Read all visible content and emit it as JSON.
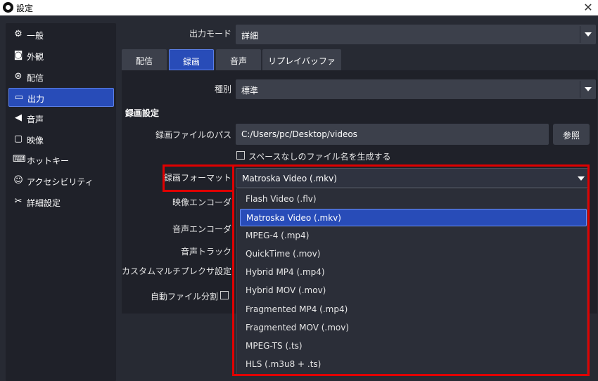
{
  "window": {
    "title": "設定",
    "close_glyph": "✕"
  },
  "sidebar": {
    "items": [
      {
        "label": "一般",
        "icon": "gear-icon",
        "glyph": "⚙"
      },
      {
        "label": "外観",
        "icon": "appearance-icon",
        "glyph": "◙"
      },
      {
        "label": "配信",
        "icon": "broadcast-icon",
        "glyph": "⊛"
      },
      {
        "label": "出力",
        "icon": "output-icon",
        "glyph": "▭"
      },
      {
        "label": "音声",
        "icon": "speaker-icon",
        "glyph": "◀"
      },
      {
        "label": "映像",
        "icon": "monitor-icon",
        "glyph": "▢"
      },
      {
        "label": "ホットキー",
        "icon": "keyboard-icon",
        "glyph": "⌨"
      },
      {
        "label": "アクセシビリティ",
        "icon": "accessibility-icon",
        "glyph": "☺"
      },
      {
        "label": "詳細設定",
        "icon": "tools-icon",
        "glyph": "✂"
      }
    ],
    "active_index": 3
  },
  "output_mode": {
    "label": "出力モード",
    "value": "詳細"
  },
  "tabs": [
    {
      "label": "配信"
    },
    {
      "label": "録画"
    },
    {
      "label": "音声"
    },
    {
      "label": "リプレイバッファ"
    }
  ],
  "active_tab": 1,
  "type_field": {
    "label": "種別",
    "value": "標準"
  },
  "recording_section": {
    "title": "録画設定",
    "path_label": "録画ファイルのパス",
    "path_value": "C:/Users/pc/Desktop/videos",
    "browse_label": "参照",
    "nospace_checkbox_label": "スペースなしのファイル名を生成する",
    "format_label": "録画フォーマット",
    "format_value": "Matroska Video (.mkv)",
    "video_encoder_label": "映像エンコーダ",
    "audio_encoder_label": "音声エンコーダ",
    "audio_track_label": "音声トラック",
    "muxer_label": "カスタムマルチプレクサ設定",
    "auto_split_label": "自動ファイル分割"
  },
  "format_dropdown": {
    "options": [
      "Flash Video (.flv)",
      "Matroska Video (.mkv)",
      "MPEG-4 (.mp4)",
      "QuickTime (.mov)",
      "Hybrid MP4 (.mp4)",
      "Hybrid MOV (.mov)",
      "Fragmented MP4 (.mp4)",
      "Fragmented MOV (.mov)",
      "MPEG-TS (.ts)",
      "HLS (.m3u8 + .ts)"
    ],
    "selected_index": 1
  },
  "colors": {
    "accent": "#284cb8",
    "highlight": "#e00000",
    "panel": "#1f2129",
    "background": "#272a33",
    "control": "#3c404b"
  }
}
